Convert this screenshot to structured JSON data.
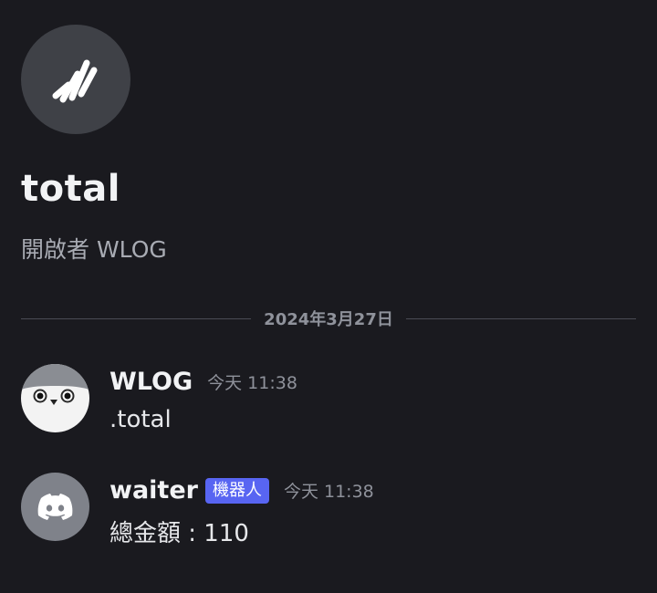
{
  "channel": {
    "icon": "thread-icon",
    "title": "total",
    "subtitle": "開啟者 WLOG"
  },
  "divider": {
    "date": "2024年3月27日"
  },
  "messages": [
    {
      "author": "WLOG",
      "avatar": "bird-avatar",
      "timestamp": "今天 11:38",
      "content": ".total"
    },
    {
      "author": "waiter",
      "avatar": "discord-logo-avatar",
      "bot_tag": "機器人",
      "timestamp": "今天 11:38",
      "content": "總金額 : 110"
    }
  ],
  "colors": {
    "background": "#1a1a1f",
    "accent": "#5865f2",
    "muted_text": "#8f929b"
  }
}
